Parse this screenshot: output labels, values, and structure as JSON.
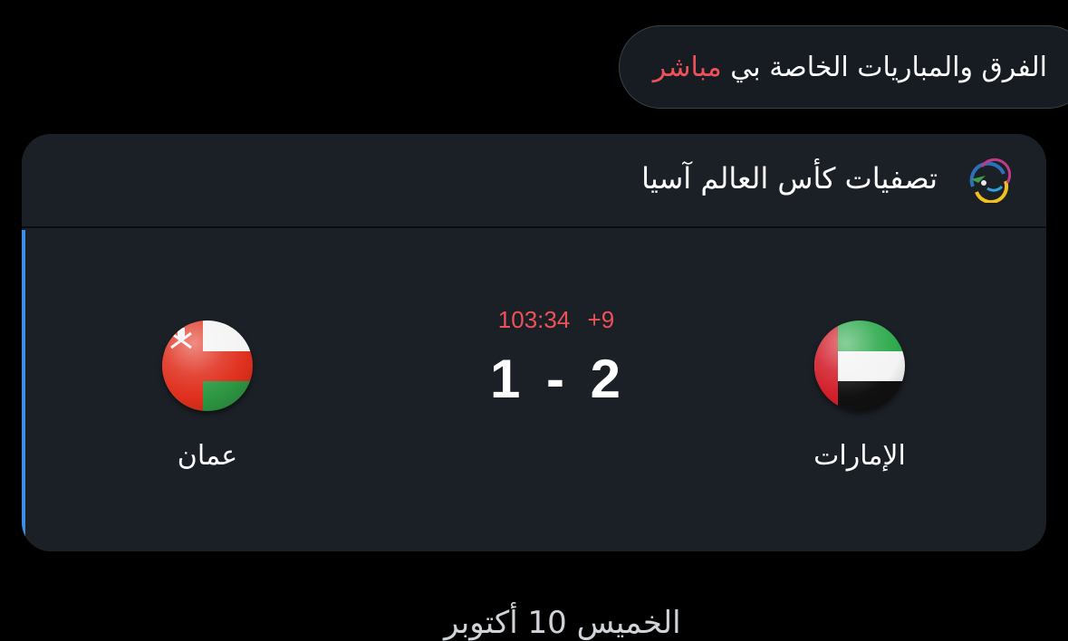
{
  "filter": {
    "prefix": "الفرق والمباريات الخاصة بي",
    "live_label": "مباشر",
    "live_color": "#f0505a"
  },
  "match_card": {
    "competition": {
      "title": "تصفيات كأس العالم آسيا",
      "icon": "afc-competition-icon"
    },
    "status": {
      "elapsed": "103:34",
      "added_time": "+9",
      "color": "#f0505a"
    },
    "score": {
      "home": "2",
      "separator": "-",
      "away": "1"
    },
    "home_team": {
      "name": "الإمارات",
      "flag": "uae-flag-icon"
    },
    "away_team": {
      "name": "عمان",
      "flag": "oman-flag-icon"
    },
    "live_indicator_color": "#3e8ee8"
  },
  "next_section": {
    "date_label": "الخميس 10 أكتوبر"
  }
}
